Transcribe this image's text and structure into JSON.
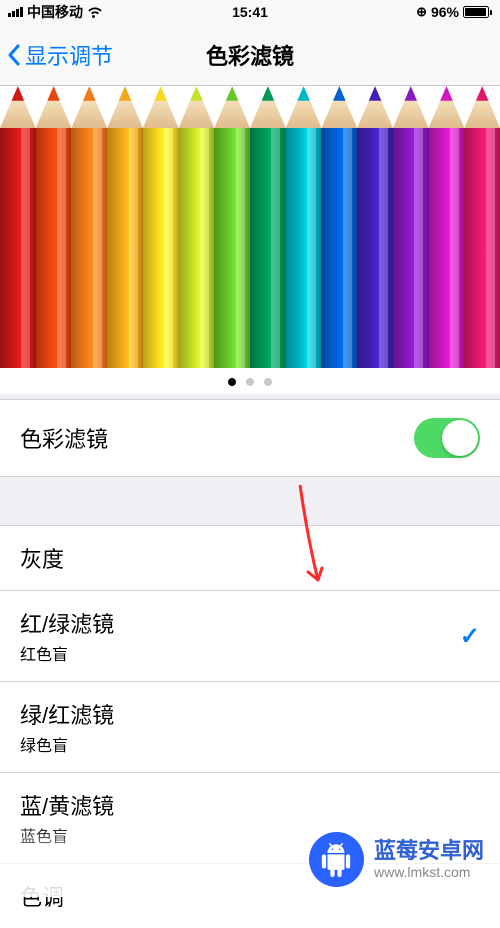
{
  "status": {
    "carrier": "中国移动",
    "time": "15:41",
    "battery_pct": "96%"
  },
  "nav": {
    "back_label": "显示调节",
    "title": "色彩滤镜"
  },
  "pencil_colors": [
    "#d01818",
    "#e84510",
    "#f07a1a",
    "#f0a818",
    "#f5d820",
    "#c8e028",
    "#68c828",
    "#009858",
    "#00b8c8",
    "#0060d0",
    "#4020b8",
    "#8818c0",
    "#d018c0",
    "#e0186a"
  ],
  "carousel": {
    "page_count": 3,
    "active_index": 0
  },
  "toggle": {
    "label": "色彩滤镜",
    "enabled": true
  },
  "options": [
    {
      "label": "灰度",
      "sublabel": "",
      "checked": false
    },
    {
      "label": "红/绿滤镜",
      "sublabel": "红色盲",
      "checked": true
    },
    {
      "label": "绿/红滤镜",
      "sublabel": "绿色盲",
      "checked": false
    },
    {
      "label": "蓝/黄滤镜",
      "sublabel": "蓝色盲",
      "checked": false
    },
    {
      "label": "色调",
      "sublabel": "",
      "checked": false
    }
  ],
  "watermark": {
    "title": "蓝莓安卓网",
    "url": "www.lmkst.com"
  }
}
